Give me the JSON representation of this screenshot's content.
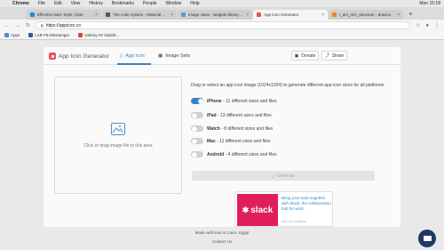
{
  "menubar": {
    "app": "Chrome",
    "items": [
      "File",
      "Edit",
      "View",
      "History",
      "Bookmarks",
      "People",
      "Window",
      "Help"
    ],
    "clock": "Mon 15:18"
  },
  "tabs": [
    {
      "title": "Effective Dart: Style | Dart",
      "color": "#1f8ad3"
    },
    {
      "title": "The color system - Material Des...",
      "color": "#555555"
    },
    {
      "title": "Image class - widgets library - ...",
      "color": "#4aa3df"
    },
    {
      "title": "App Icon Generator",
      "color": "#f04d5b"
    },
    {
      "title": "I_am_rich_structure - draw.io",
      "color": "#f08705"
    }
  ],
  "addressbar": {
    "url": "https://appicon.co"
  },
  "bookmarks": [
    {
      "label": "Apps",
      "color": "#4a90d9"
    },
    {
      "label": "LAB FB Messenger",
      "color": "#3b5998"
    },
    {
      "label": "Udemy AF Dashb...",
      "color": "#e0413a"
    }
  ],
  "app": {
    "title": "App Icon Generator",
    "nav": {
      "app_icon": "App Icon",
      "image_sets": "Image Sets"
    },
    "donate": "Donate",
    "share": "Share",
    "dropzone_text": "Click or drag image file to this area",
    "description": "Drag or select an app icon image (1024x1024) to generate different app icon sizes for all platforms",
    "options": [
      {
        "name": "iPhone",
        "detail": " - 11 different sizes and files",
        "on": true
      },
      {
        "name": "iPad",
        "detail": " - 13 different sizes and files",
        "on": false
      },
      {
        "name": "Watch",
        "detail": " - 8 different sizes and files",
        "on": false
      },
      {
        "name": "Mac",
        "detail": " - 11 different sizes and files",
        "on": false
      },
      {
        "name": "Android",
        "detail": " - 4 different sizes and files",
        "on": false
      }
    ],
    "generate": "Generate",
    "ad": {
      "brand": "slack",
      "text": "Bring your team together with Slack, the collaboration hub for work.",
      "via": "ADS VIA CARBON"
    },
    "footer": {
      "made": "Made with love in Cairo, Egypt",
      "contact": "Contact Us"
    }
  },
  "colors": {
    "accent": "#3b82c4",
    "brand": "#f04d5b",
    "slack": "#e01e5a",
    "chat": "#1e3a63"
  }
}
